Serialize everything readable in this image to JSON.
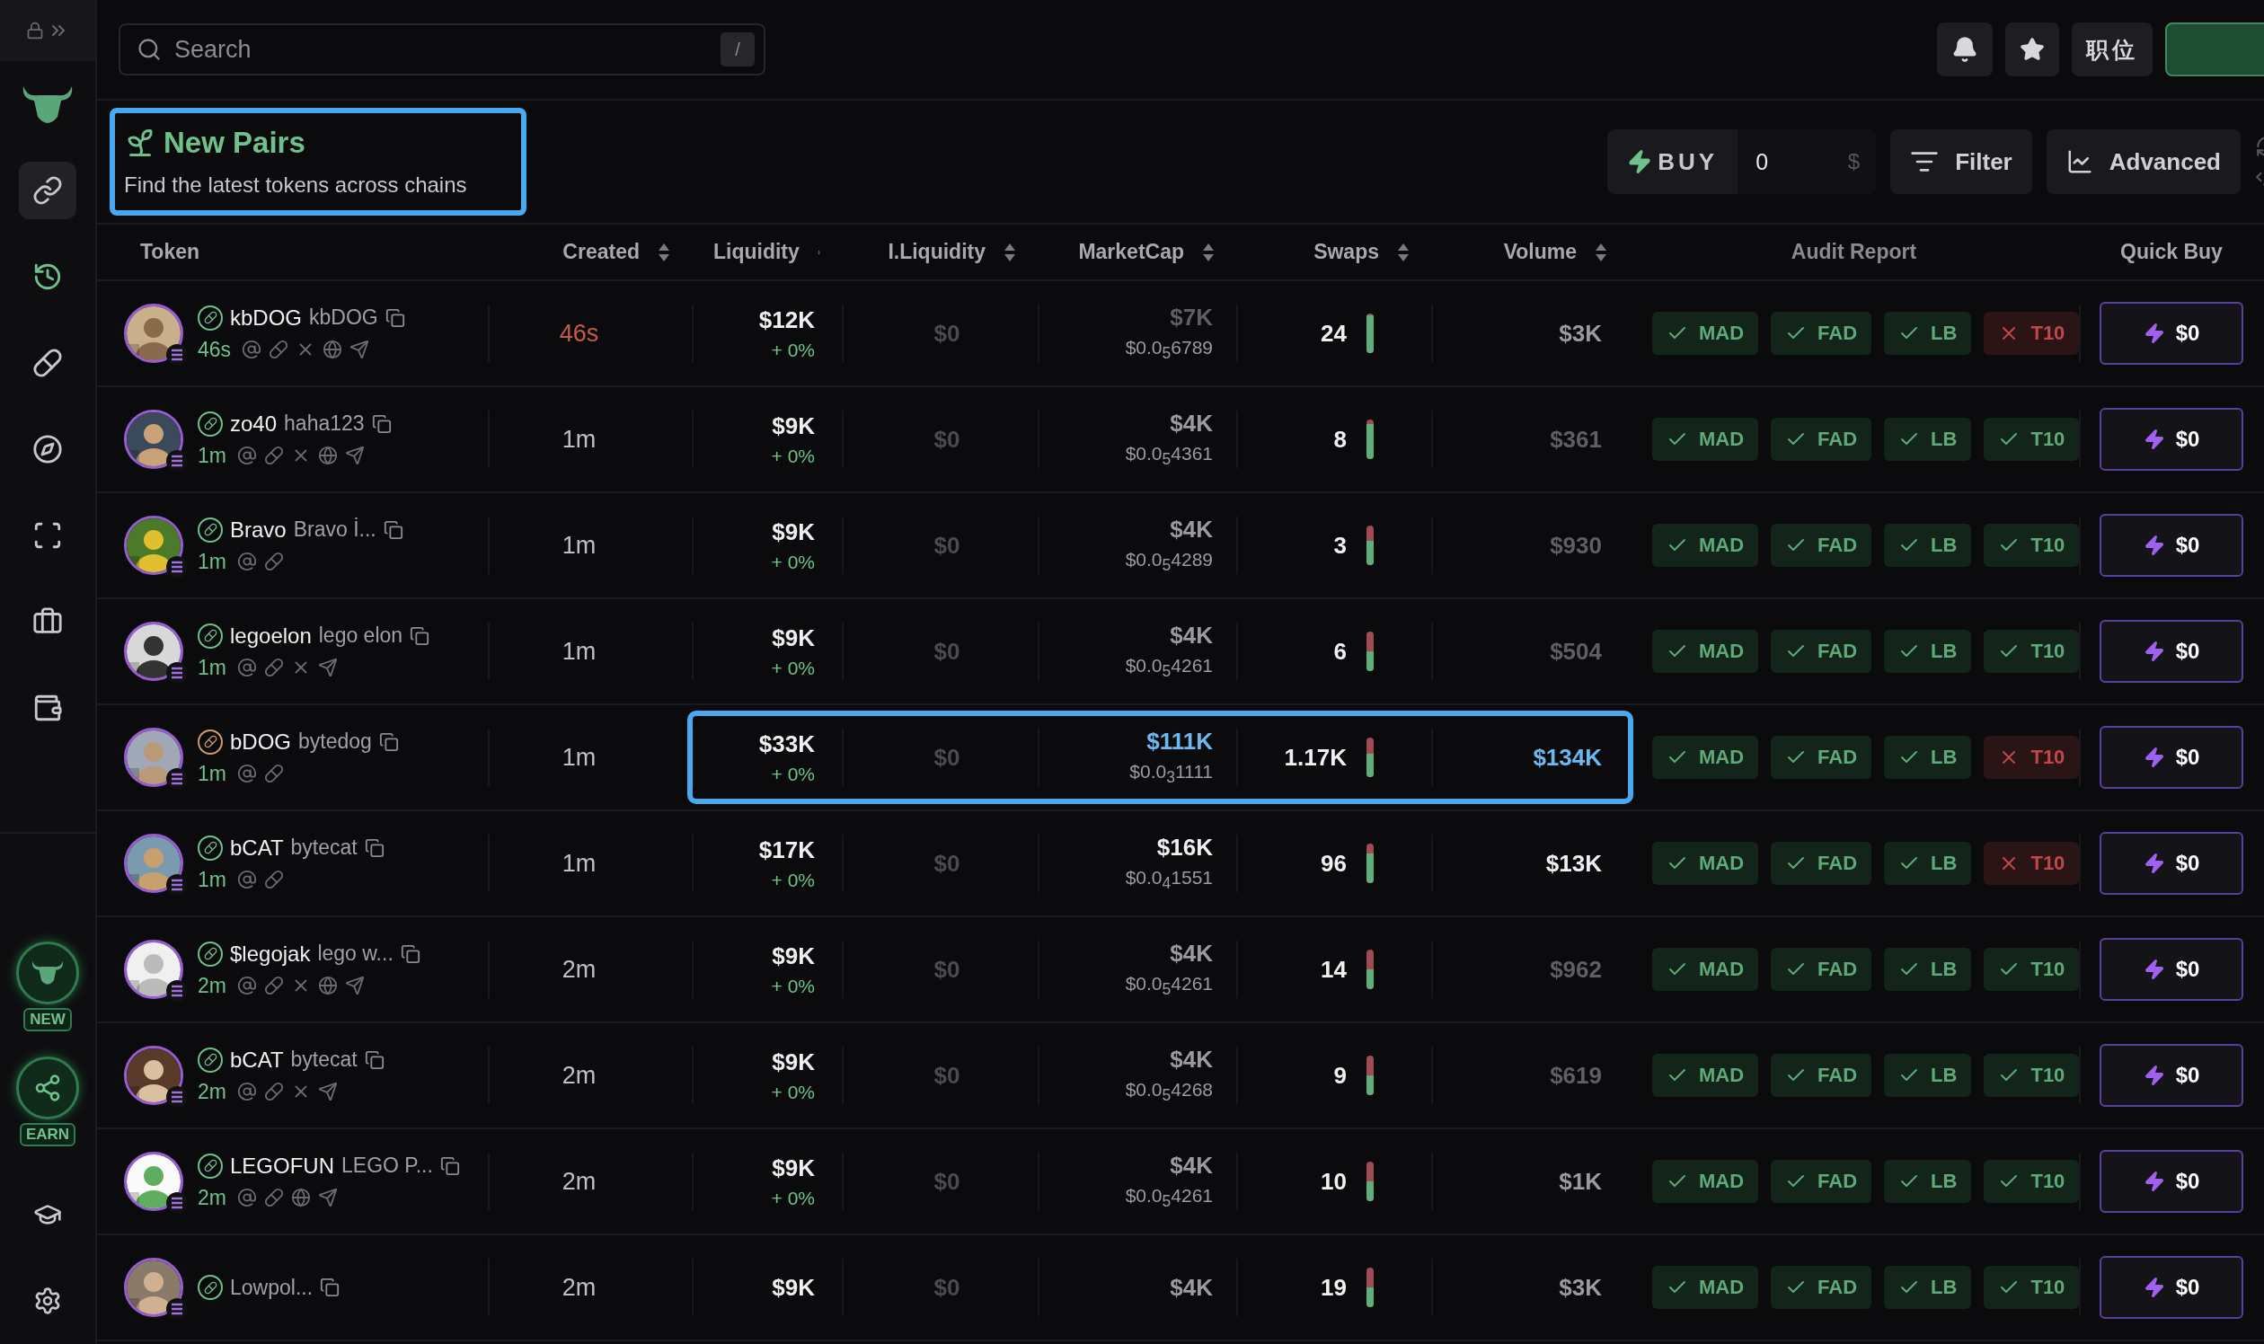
{
  "sidebar": {
    "nav": [
      {
        "selected": true
      },
      {
        "selected": false
      },
      {
        "selected": false
      },
      {
        "selected": false
      },
      {
        "selected": false
      },
      {
        "selected": false
      },
      {
        "selected": false
      }
    ],
    "badges": [
      {
        "label": "NEW"
      },
      {
        "label": "EARN"
      }
    ]
  },
  "top_bar": {
    "search": {
      "placeholder": "Search",
      "shortcut": "/"
    },
    "position_button": "职位"
  },
  "header": {
    "title": "New Pairs",
    "subtitle": "Find the latest tokens across chains",
    "highlighted": true,
    "buy": {
      "label": "BUY",
      "value": "0",
      "unit": "$"
    },
    "filter": "Filter",
    "advanced": "Advanced"
  },
  "table": {
    "columns": [
      {
        "label": "Token",
        "sortable": false
      },
      {
        "label": "Created",
        "sortable": true
      },
      {
        "label": "Liquidity",
        "sortable": true
      },
      {
        "label": "I.Liquidity",
        "sortable": true
      },
      {
        "label": "MarketCap",
        "sortable": true
      },
      {
        "label": "Swaps",
        "sortable": true
      },
      {
        "label": "Volume",
        "sortable": true
      },
      {
        "label": "Audit Report",
        "sortable": false
      },
      {
        "label": "Quick Buy",
        "sortable": false
      }
    ],
    "rows": [
      {
        "symbol": "kbDOG",
        "name": "kbDOG",
        "platform": {
          "color": "#6fc08a"
        },
        "age": "46s",
        "socials": [
          {
            "kind": "at"
          },
          {
            "kind": "pill"
          },
          {
            "kind": "x"
          },
          {
            "kind": "globe"
          },
          {
            "kind": "telegram"
          }
        ],
        "created": "46s",
        "fresh": true,
        "liquidity": "$12K",
        "liquidity_change": "+ 0%",
        "initial_liquidity": "$0",
        "market_cap": {
          "value": "$7K",
          "color": "#5e5e64"
        },
        "price": "$0.0$_{5}$6789",
        "swaps": "24",
        "level": 0.95,
        "volume": {
          "value": "$3K",
          "color": "#9a9aa0"
        },
        "highlighted": false,
        "audit": [
          {
            "label": "MAD",
            "passed": true
          },
          {
            "label": "FAD",
            "passed": true
          },
          {
            "label": "LB",
            "passed": true
          },
          {
            "label": "T10",
            "passed": false
          }
        ],
        "quick_buy": "$0"
      },
      {
        "symbol": "zo40",
        "name": "haha123",
        "platform": {
          "color": "#6fc08a"
        },
        "age": "1m",
        "socials": [
          {
            "kind": "at"
          },
          {
            "kind": "pill"
          },
          {
            "kind": "x"
          },
          {
            "kind": "globe"
          },
          {
            "kind": "telegram"
          }
        ],
        "created": "1m",
        "fresh": false,
        "liquidity": "$9K",
        "liquidity_change": "+ 0%",
        "initial_liquidity": "$0",
        "market_cap": {
          "value": "$4K",
          "color": "#9a9aa0"
        },
        "price": "$0.0$_{5}$4361",
        "swaps": "8",
        "level": 0.88,
        "volume": {
          "value": "$361",
          "color": "#5e5e64"
        },
        "highlighted": false,
        "audit": [
          {
            "label": "MAD",
            "passed": true
          },
          {
            "label": "FAD",
            "passed": true
          },
          {
            "label": "LB",
            "passed": true
          },
          {
            "label": "T10",
            "passed": true
          }
        ],
        "quick_buy": "$0"
      },
      {
        "symbol": "Bravo",
        "name": "Bravo İ...",
        "platform": {
          "color": "#6fc08a"
        },
        "age": "1m",
        "socials": [
          {
            "kind": "at"
          },
          {
            "kind": "pill"
          }
        ],
        "created": "1m",
        "fresh": false,
        "liquidity": "$9K",
        "liquidity_change": "+ 0%",
        "initial_liquidity": "$0",
        "market_cap": {
          "value": "$4K",
          "color": "#9a9aa0"
        },
        "price": "$0.0$_{5}$4289",
        "swaps": "3",
        "level": 0.62,
        "volume": {
          "value": "$930",
          "color": "#5e5e64"
        },
        "highlighted": false,
        "audit": [
          {
            "label": "MAD",
            "passed": true
          },
          {
            "label": "FAD",
            "passed": true
          },
          {
            "label": "LB",
            "passed": true
          },
          {
            "label": "T10",
            "passed": true
          }
        ],
        "quick_buy": "$0"
      },
      {
        "symbol": "legoelon",
        "name": "lego elon",
        "platform": {
          "color": "#6fc08a"
        },
        "age": "1m",
        "socials": [
          {
            "kind": "at"
          },
          {
            "kind": "pill"
          },
          {
            "kind": "x"
          },
          {
            "kind": "telegram"
          }
        ],
        "created": "1m",
        "fresh": false,
        "liquidity": "$9K",
        "liquidity_change": "+ 0%",
        "initial_liquidity": "$0",
        "market_cap": {
          "value": "$4K",
          "color": "#9a9aa0"
        },
        "price": "$0.0$_{5}$4261",
        "swaps": "6",
        "level": 0.5,
        "volume": {
          "value": "$504",
          "color": "#5e5e64"
        },
        "highlighted": false,
        "audit": [
          {
            "label": "MAD",
            "passed": true
          },
          {
            "label": "FAD",
            "passed": true
          },
          {
            "label": "LB",
            "passed": true
          },
          {
            "label": "T10",
            "passed": true
          }
        ],
        "quick_buy": "$0"
      },
      {
        "symbol": "bDOG",
        "name": "bytedog",
        "platform": {
          "color": "#d09a6a"
        },
        "age": "1m",
        "socials": [
          {
            "kind": "at"
          },
          {
            "kind": "pill"
          }
        ],
        "created": "1m",
        "fresh": false,
        "liquidity": "$33K",
        "liquidity_change": "+ 0%",
        "initial_liquidity": "$0",
        "market_cap": {
          "value": "$111K",
          "color": "#6cb8f0"
        },
        "price": "$0.0$_{3}$1111",
        "swaps": "1.17K",
        "level": 0.6,
        "volume": {
          "value": "$134K",
          "color": "#6cb8f0"
        },
        "highlighted": true,
        "audit": [
          {
            "label": "MAD",
            "passed": true
          },
          {
            "label": "FAD",
            "passed": true
          },
          {
            "label": "LB",
            "passed": true
          },
          {
            "label": "T10",
            "passed": false
          }
        ],
        "quick_buy": "$0"
      },
      {
        "symbol": "bCAT",
        "name": "bytecat",
        "platform": {
          "color": "#6fc08a"
        },
        "age": "1m",
        "socials": [
          {
            "kind": "at"
          },
          {
            "kind": "pill"
          }
        ],
        "created": "1m",
        "fresh": false,
        "liquidity": "$17K",
        "liquidity_change": "+ 0%",
        "initial_liquidity": "$0",
        "market_cap": {
          "value": "$16K",
          "color": "#f0f0f2"
        },
        "price": "$0.0$_{4}$1551",
        "swaps": "96",
        "level": 0.75,
        "volume": {
          "value": "$13K",
          "color": "#f0f0f2"
        },
        "highlighted": false,
        "audit": [
          {
            "label": "MAD",
            "passed": true
          },
          {
            "label": "FAD",
            "passed": true
          },
          {
            "label": "LB",
            "passed": true
          },
          {
            "label": "T10",
            "passed": false
          }
        ],
        "quick_buy": "$0"
      },
      {
        "symbol": "$legojak",
        "name": "lego w...",
        "platform": {
          "color": "#6fc08a"
        },
        "age": "2m",
        "socials": [
          {
            "kind": "at"
          },
          {
            "kind": "pill"
          },
          {
            "kind": "x"
          },
          {
            "kind": "globe"
          },
          {
            "kind": "telegram"
          }
        ],
        "created": "2m",
        "fresh": false,
        "liquidity": "$9K",
        "liquidity_change": "+ 0%",
        "initial_liquidity": "$0",
        "market_cap": {
          "value": "$4K",
          "color": "#9a9aa0"
        },
        "price": "$0.0$_{5}$4261",
        "swaps": "14",
        "level": 0.5,
        "volume": {
          "value": "$962",
          "color": "#5e5e64"
        },
        "highlighted": false,
        "audit": [
          {
            "label": "MAD",
            "passed": true
          },
          {
            "label": "FAD",
            "passed": true
          },
          {
            "label": "LB",
            "passed": true
          },
          {
            "label": "T10",
            "passed": true
          }
        ],
        "quick_buy": "$0"
      },
      {
        "symbol": "bCAT",
        "name": "bytecat",
        "platform": {
          "color": "#6fc08a"
        },
        "age": "2m",
        "socials": [
          {
            "kind": "at"
          },
          {
            "kind": "pill"
          },
          {
            "kind": "x"
          },
          {
            "kind": "telegram"
          }
        ],
        "created": "2m",
        "fresh": false,
        "liquidity": "$9K",
        "liquidity_change": "+ 0%",
        "initial_liquidity": "$0",
        "market_cap": {
          "value": "$4K",
          "color": "#9a9aa0"
        },
        "price": "$0.0$_{5}$4268",
        "swaps": "9",
        "level": 0.5,
        "volume": {
          "value": "$619",
          "color": "#5e5e64"
        },
        "highlighted": false,
        "audit": [
          {
            "label": "MAD",
            "passed": true
          },
          {
            "label": "FAD",
            "passed": true
          },
          {
            "label": "LB",
            "passed": true
          },
          {
            "label": "T10",
            "passed": true
          }
        ],
        "quick_buy": "$0"
      },
      {
        "symbol": "LEGOFUN",
        "name": "LEGO P...",
        "platform": {
          "color": "#6fc08a"
        },
        "age": "2m",
        "socials": [
          {
            "kind": "at"
          },
          {
            "kind": "pill"
          },
          {
            "kind": "globe"
          },
          {
            "kind": "telegram"
          }
        ],
        "created": "2m",
        "fresh": false,
        "liquidity": "$9K",
        "liquidity_change": "+ 0%",
        "initial_liquidity": "$0",
        "market_cap": {
          "value": "$4K",
          "color": "#9a9aa0"
        },
        "price": "$0.0$_{5}$4261",
        "swaps": "10",
        "level": 0.5,
        "volume": {
          "value": "$1K",
          "color": "#9a9aa0"
        },
        "highlighted": false,
        "audit": [
          {
            "label": "MAD",
            "passed": true
          },
          {
            "label": "FAD",
            "passed": true
          },
          {
            "label": "LB",
            "passed": true
          },
          {
            "label": "T10",
            "passed": true
          }
        ],
        "quick_buy": "$0"
      },
      {
        "name": "Lowpol...",
        "platform": {
          "color": "#6fc08a"
        },
        "created": "2m",
        "fresh": false,
        "liquidity": "$9K",
        "initial_liquidity": "$0",
        "market_cap": {
          "value": "$4K",
          "color": "#9a9aa0"
        },
        "swaps": "19",
        "level": 0.5,
        "volume": {
          "value": "$3K",
          "color": "#9a9aa0"
        },
        "highlighted": false,
        "audit": [
          {
            "label": "MAD",
            "passed": true
          },
          {
            "label": "FAD",
            "passed": true
          },
          {
            "label": "LB",
            "passed": true
          },
          {
            "label": "T10",
            "passed": true
          }
        ],
        "quick_buy": "$0"
      }
    ]
  }
}
